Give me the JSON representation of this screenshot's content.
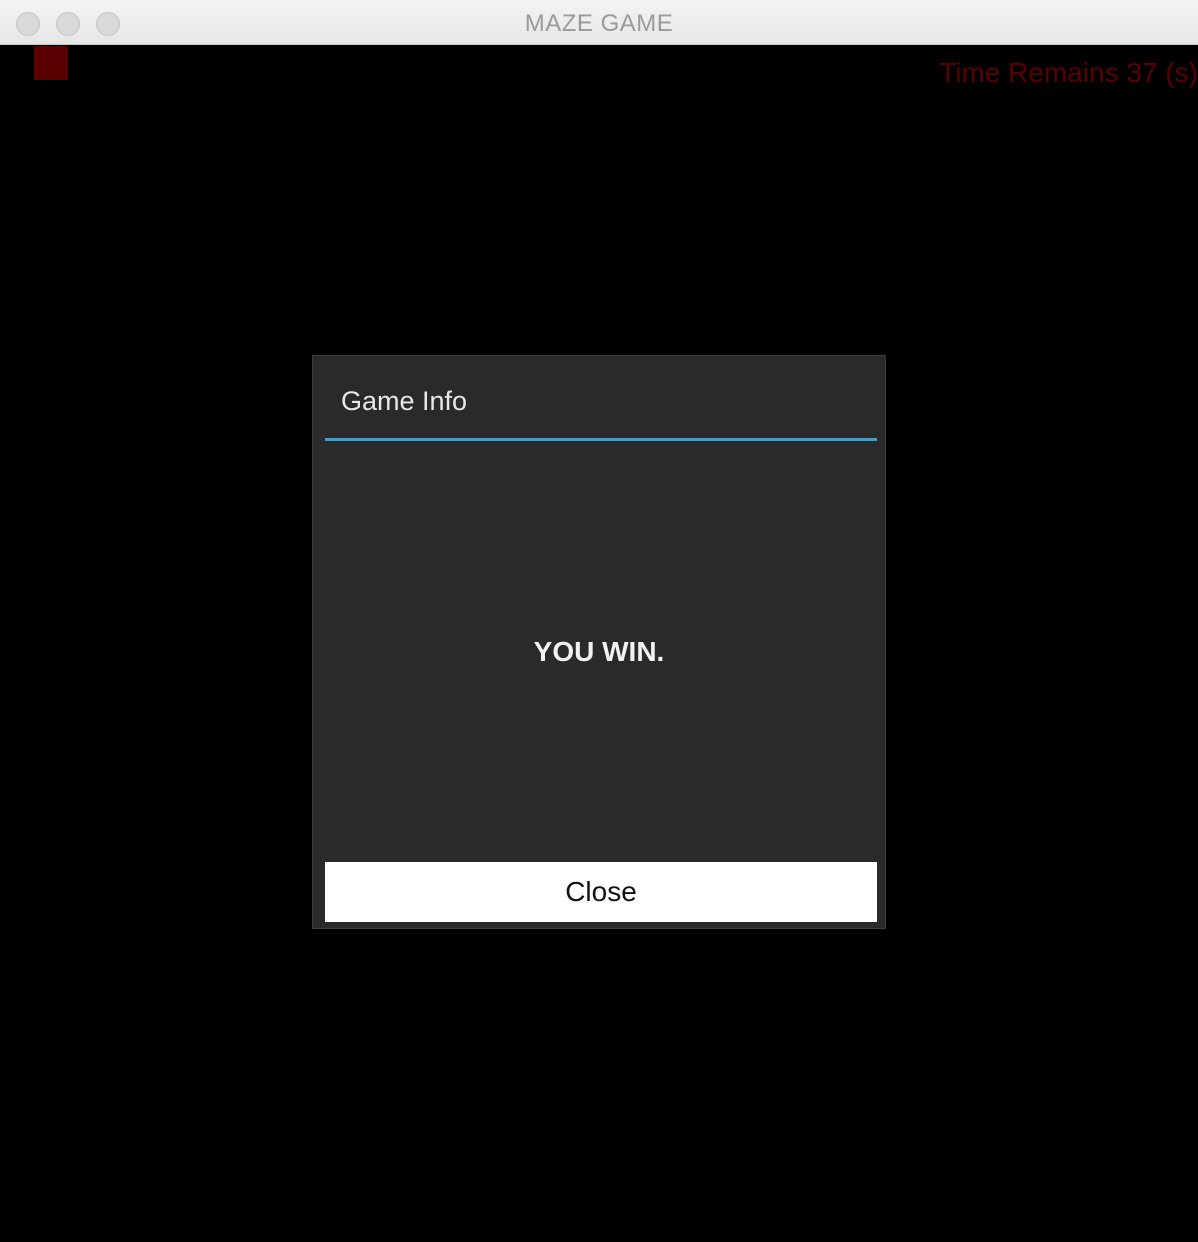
{
  "window": {
    "title": "MAZE GAME"
  },
  "game": {
    "timer_text": "Time Remains 37 (s)",
    "colors": {
      "background": "#000000",
      "wall": "#4a4a4a",
      "player": "#5a0000",
      "timer": "#5a0000"
    }
  },
  "dialog": {
    "title": "Game Info",
    "message": "YOU WIN.",
    "close_label": "Close",
    "accent": "#33a3d9"
  }
}
